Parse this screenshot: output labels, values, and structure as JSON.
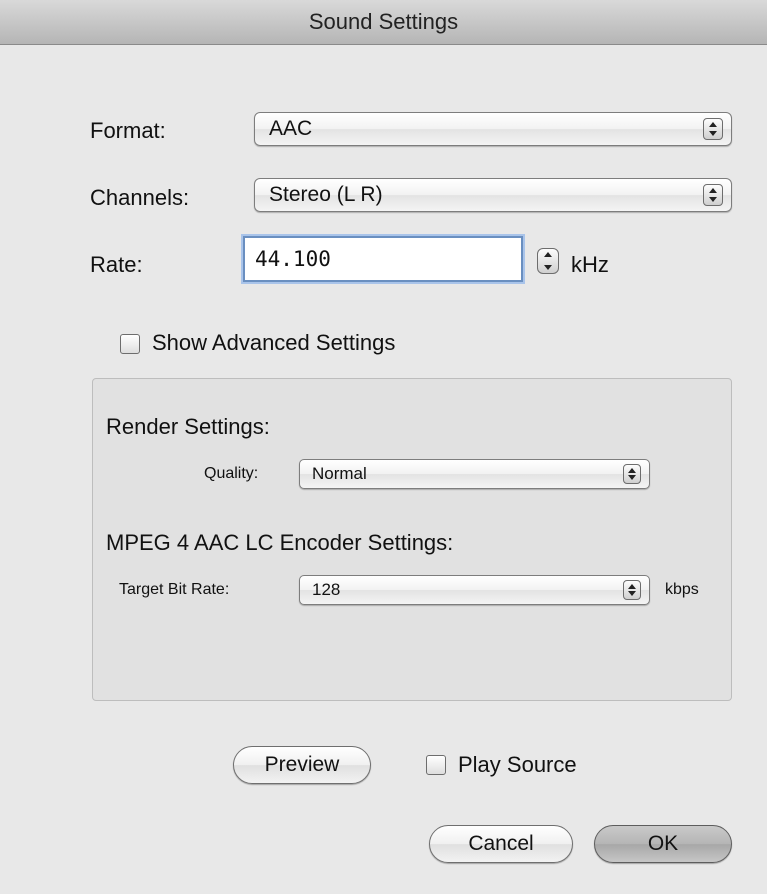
{
  "window": {
    "title": "Sound Settings"
  },
  "format": {
    "label": "Format:",
    "value": "AAC"
  },
  "channels": {
    "label": "Channels:",
    "value": "Stereo (L R)"
  },
  "rate": {
    "label": "Rate:",
    "value": "44.100",
    "unit": "kHz"
  },
  "advanced": {
    "label": "Show Advanced Settings",
    "checked": false
  },
  "render": {
    "heading": "Render Settings:",
    "quality_label": "Quality:",
    "quality_value": "Normal"
  },
  "encoder": {
    "heading": "MPEG 4 AAC LC Encoder Settings:",
    "bitrate_label": "Target Bit Rate:",
    "bitrate_value": "128",
    "bitrate_unit": "kbps"
  },
  "footer": {
    "preview_label": "Preview",
    "play_source_label": "Play Source",
    "cancel_label": "Cancel",
    "ok_label": "OK"
  },
  "icons": {
    "updown": "updown-arrows-icon"
  }
}
